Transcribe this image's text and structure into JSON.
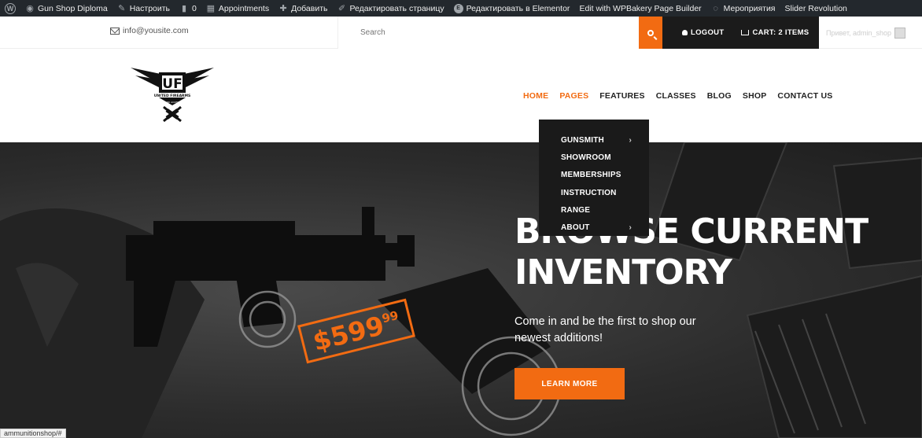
{
  "adminbar": {
    "items": [
      {
        "icon": "wordpress-icon",
        "label": ""
      },
      {
        "icon": "dashboard-icon",
        "label": "Gun Shop Diploma"
      },
      {
        "icon": "brush-icon",
        "label": "Настроить"
      },
      {
        "icon": "comment-icon",
        "label": "0"
      },
      {
        "icon": "calendar-icon",
        "label": "Appointments"
      },
      {
        "icon": "plus-icon",
        "label": "Добавить"
      },
      {
        "icon": "pencil-icon",
        "label": "Редактировать страницу"
      },
      {
        "icon": "elementor-icon",
        "label": "Редактировать в Elementor"
      },
      {
        "icon": "",
        "label": "Edit with WPBakery Page Builder"
      },
      {
        "icon": "events-icon",
        "label": "Мероприятия"
      },
      {
        "icon": "",
        "label": "Slider Revolution"
      }
    ]
  },
  "topbar": {
    "email": "info@yousite.com",
    "search_placeholder": "Search",
    "logout": "LOGOUT",
    "cart": "CART: 2 ITEMS",
    "user": "Привет, admin_shop"
  },
  "logo": {
    "main": "UF",
    "sub": "UNITED FIREARMS",
    "sub2": "GUNS AND ACCESSORIES"
  },
  "nav": [
    "HOME",
    "PAGES",
    "FEATURES",
    "CLASSES",
    "BLOG",
    "SHOP",
    "CONTACT US"
  ],
  "dropdown": [
    {
      "label": "GUNSMITH",
      "arrow": "›"
    },
    {
      "label": "SHOWROOM",
      "arrow": ""
    },
    {
      "label": "MEMBERSHIPS",
      "arrow": ""
    },
    {
      "label": "INSTRUCTION",
      "arrow": ""
    },
    {
      "label": "RANGE",
      "arrow": ""
    },
    {
      "label": "ABOUT",
      "arrow": "›"
    }
  ],
  "hero": {
    "title_line1": "BROWSE CURRENT",
    "title_line2": "INVENTORY",
    "subtitle": "Come in and be the first to shop our newest additions!",
    "button": "LEARN MORE",
    "price_main": "$599",
    "price_cents": "99"
  },
  "status_url": "ammunitionshop/#",
  "colors": {
    "accent": "#f26b12",
    "adminbar": "#23282d",
    "dark": "#1b1b1b"
  }
}
